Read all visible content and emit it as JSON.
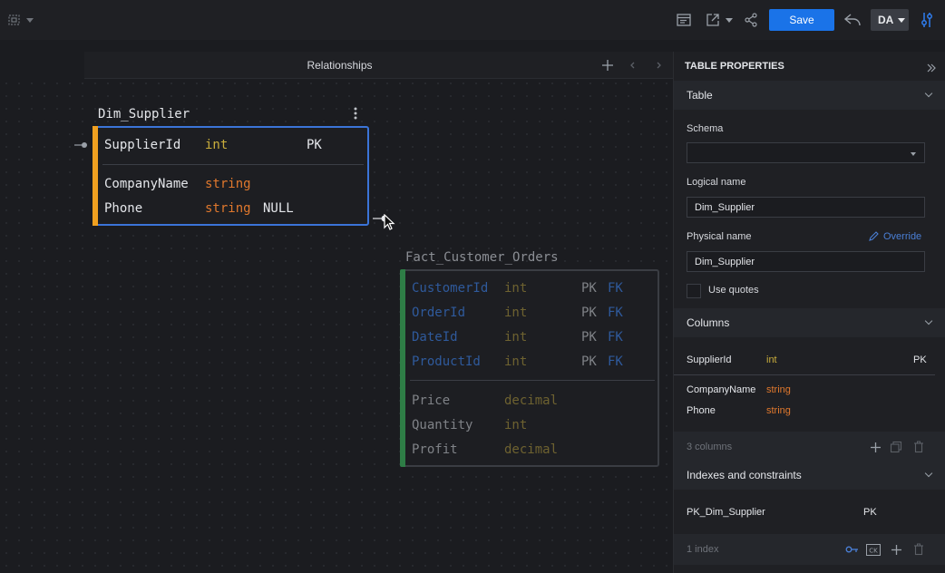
{
  "toolbar": {
    "save_label": "Save",
    "user_initials": "DA"
  },
  "canvas": {
    "tab_label": "Relationships"
  },
  "entities": {
    "dim_supplier": {
      "title": "Dim_Supplier",
      "key_columns": [
        {
          "name": "SupplierId",
          "type": "int",
          "key": "PK"
        }
      ],
      "columns": [
        {
          "name": "CompanyName",
          "type": "string",
          "nullable": ""
        },
        {
          "name": "Phone",
          "type": "string",
          "nullable": "NULL"
        }
      ]
    },
    "fact_customer_orders": {
      "title": "Fact_Customer_Orders",
      "key_columns": [
        {
          "name": "CustomerId",
          "type": "int",
          "pk": "PK",
          "fk": "FK"
        },
        {
          "name": "OrderId",
          "type": "int",
          "pk": "PK",
          "fk": "FK"
        },
        {
          "name": "DateId",
          "type": "int",
          "pk": "PK",
          "fk": "FK"
        },
        {
          "name": "ProductId",
          "type": "int",
          "pk": "PK",
          "fk": "FK"
        }
      ],
      "columns": [
        {
          "name": "Price",
          "type": "decimal"
        },
        {
          "name": "Quantity",
          "type": "int"
        },
        {
          "name": "Profit",
          "type": "decimal"
        }
      ]
    }
  },
  "panel": {
    "title": "TABLE PROPERTIES",
    "table_section": {
      "header": "Table",
      "schema_label": "Schema",
      "schema_value": "",
      "logical_name_label": "Logical name",
      "logical_name_value": "Dim_Supplier",
      "physical_name_label": "Physical name",
      "override_label": "Override",
      "physical_name_value": "Dim_Supplier",
      "use_quotes_label": "Use quotes"
    },
    "columns_section": {
      "header": "Columns",
      "key_rows": [
        {
          "name": "SupplierId",
          "type": "int",
          "key": "PK"
        }
      ],
      "rows": [
        {
          "name": "CompanyName",
          "type": "string"
        },
        {
          "name": "Phone",
          "type": "string"
        }
      ],
      "footer": "3 columns"
    },
    "indexes_section": {
      "header": "Indexes and constraints",
      "rows": [
        {
          "name": "PK_Dim_Supplier",
          "type": "PK"
        }
      ],
      "footer": "1 index"
    }
  },
  "colors": {
    "accent": "#1a73e8",
    "selected_border": "#3b74d8",
    "dim_bar": "#f0a020",
    "fact_bar": "#2e7d46",
    "type_int": "#c9ad3c",
    "type_string": "#e0782d"
  }
}
